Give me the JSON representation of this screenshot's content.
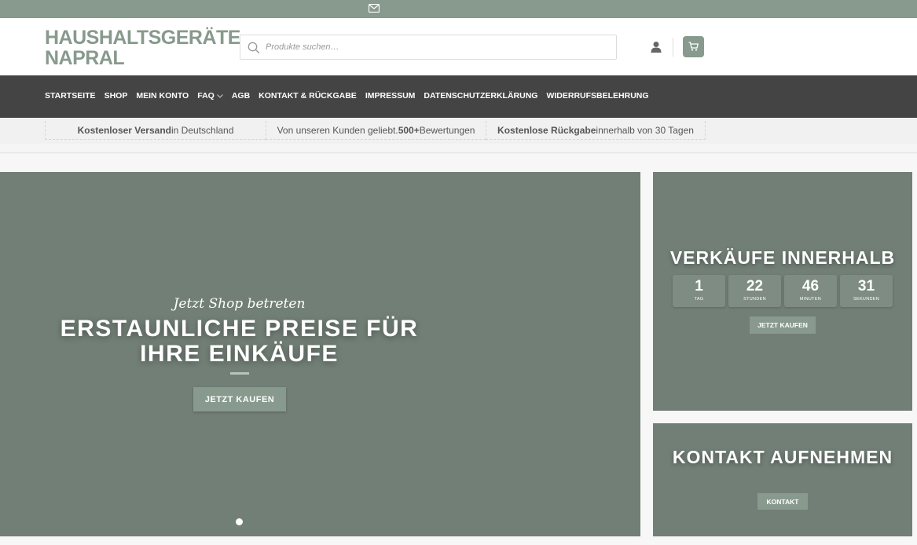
{
  "topbar": {
    "icon": "mail-icon",
    "color": "#879a8d"
  },
  "header": {
    "logo_line1": "HAUSHALTSGERÄTE",
    "logo_line2": "NAPRAL",
    "search_placeholder": "Produkte suchen…",
    "account_icon": "user-icon",
    "cart_icon": "cart-icon"
  },
  "nav": {
    "items": [
      {
        "label": "STARTSEITE"
      },
      {
        "label": "SHOP"
      },
      {
        "label": "MEIN KONTO"
      },
      {
        "label": "FAQ"
      },
      {
        "label": "AGB"
      },
      {
        "label": "KONTAKT & RÜCKGABE"
      },
      {
        "label": "IMPRESSUM"
      },
      {
        "label": "DATENSCHUTZERKLÄRUNG"
      },
      {
        "label": "WIDERRUFSBELEHRUNG"
      }
    ]
  },
  "benefits": [
    {
      "bold": "Kostenloser Versand",
      "rest": " in Deutschland"
    },
    {
      "pre": "Von unseren Kunden geliebt. ",
      "bold": "500+",
      "rest": " Bewertungen"
    },
    {
      "bold": "Kostenlose Rückgabe",
      "rest": " innerhalb von 30 Tagen"
    }
  ],
  "hero": {
    "script": "Jetzt Shop betreten",
    "title": "ERSTAUNLICHE PREISE FÜR IHRE EINKÄUFE",
    "button": "JETZT KAUFEN"
  },
  "sale_panel": {
    "title": "VERKÄUFE INNERHALB",
    "countdown": [
      {
        "value": "1",
        "unit": "TAG"
      },
      {
        "value": "22",
        "unit": "STUNDEN"
      },
      {
        "value": "46",
        "unit": "MINUTEN"
      },
      {
        "value": "31",
        "unit": "SEKUNDEN"
      }
    ],
    "button": "JETZT KAUFEN"
  },
  "contact_panel": {
    "title": "KONTAKT AUFNEHMEN",
    "button": "KONTAKT"
  },
  "colors": {
    "accent": "#879a8d",
    "panel": "#727f76",
    "nav": "#444444"
  }
}
